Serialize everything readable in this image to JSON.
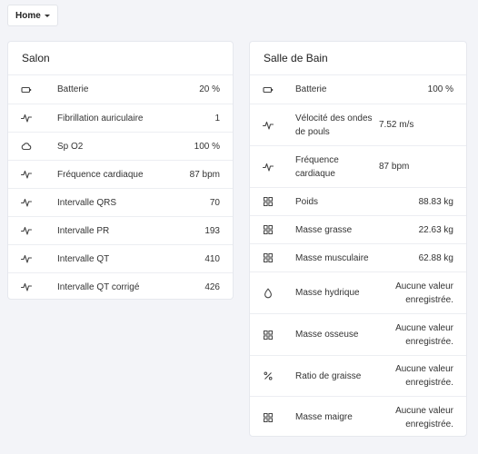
{
  "header": {
    "home_label": "Home"
  },
  "cards": [
    {
      "title": "Salon",
      "rows": [
        {
          "icon": "battery-icon",
          "label": "Batterie",
          "value": "20 %"
        },
        {
          "icon": "pulse-icon",
          "label": "Fibrillation auriculaire",
          "value": "1"
        },
        {
          "icon": "cloud-icon",
          "label": "Sp O2",
          "value": "100 %"
        },
        {
          "icon": "pulse-icon",
          "label": "Fréquence cardiaque",
          "value": "87 bpm"
        },
        {
          "icon": "pulse-icon",
          "label": "Intervalle QRS",
          "value": "70"
        },
        {
          "icon": "pulse-icon",
          "label": "Intervalle PR",
          "value": "193"
        },
        {
          "icon": "pulse-icon",
          "label": "Intervalle QT",
          "value": "410"
        },
        {
          "icon": "pulse-icon",
          "label": "Intervalle QT corrigé",
          "value": "426"
        }
      ]
    },
    {
      "title": "Salle de Bain",
      "rows": [
        {
          "icon": "battery-icon",
          "label": "Batterie",
          "value": "100 %"
        },
        {
          "icon": "pulse-icon",
          "label": "Vélocité des ondes de pouls",
          "value": "7.52 m/s"
        },
        {
          "icon": "pulse-icon",
          "label": "Fréquence cardiaque",
          "value": "87 bpm"
        },
        {
          "icon": "grid-icon",
          "label": "Poids",
          "value": "88.83 kg"
        },
        {
          "icon": "grid-icon",
          "label": "Masse grasse",
          "value": "22.63 kg"
        },
        {
          "icon": "grid-icon",
          "label": "Masse musculaire",
          "value": "62.88 kg"
        },
        {
          "icon": "droplet-icon",
          "label": "Masse hydrique",
          "value": "Aucune valeur enregistrée."
        },
        {
          "icon": "grid-icon",
          "label": "Masse osseuse",
          "value": "Aucune valeur enregistrée."
        },
        {
          "icon": "percent-icon",
          "label": "Ratio de graisse",
          "value": "Aucune valeur enregistrée."
        },
        {
          "icon": "grid-icon",
          "label": "Masse maigre",
          "value": "Aucune valeur enregistrée."
        }
      ]
    }
  ]
}
